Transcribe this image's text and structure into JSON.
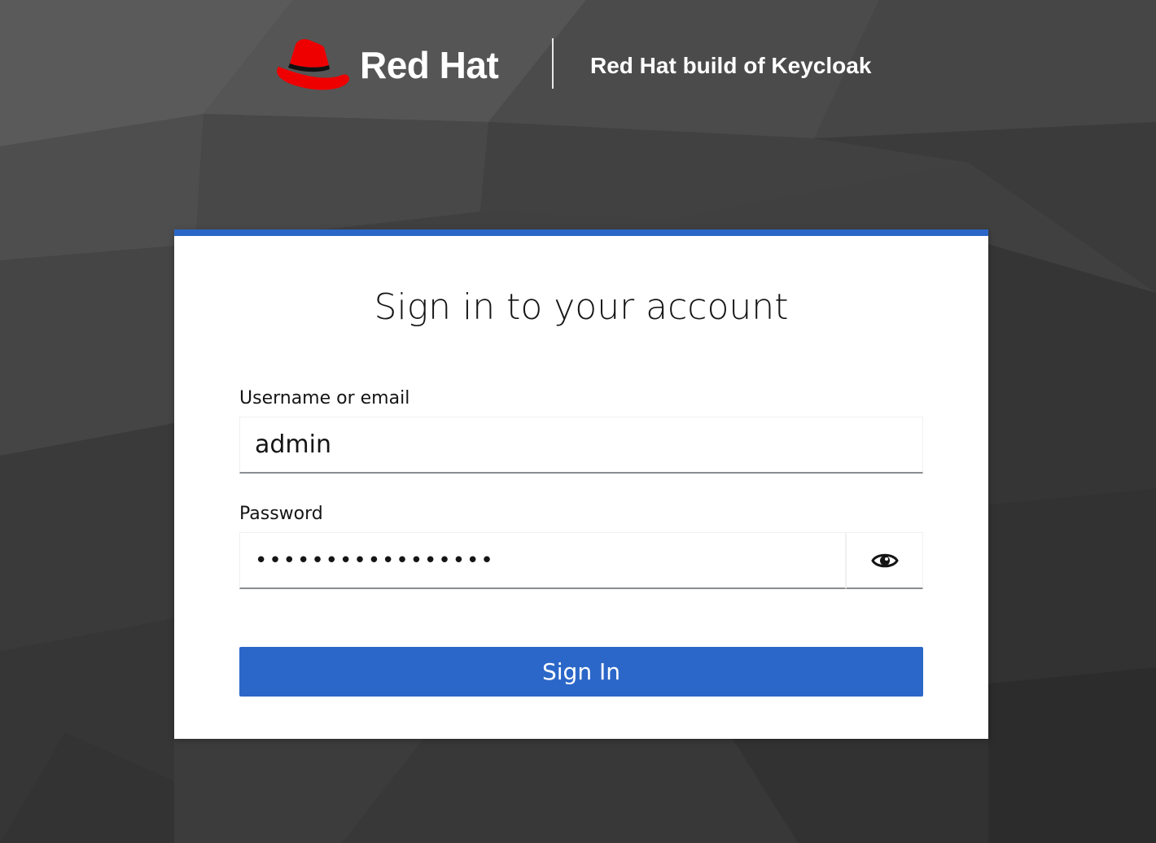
{
  "header": {
    "brand_name": "Red Hat",
    "product_name": "Red Hat build of Keycloak"
  },
  "login": {
    "title": "Sign in to your account",
    "username_label": "Username or email",
    "username_value": "admin",
    "password_label": "Password",
    "password_value": "•••••••••••••••••",
    "show_password_icon": "eye-icon",
    "submit_label": "Sign In"
  },
  "colors": {
    "background": "#3f3f3f",
    "brand_red": "#ee0000",
    "accent_blue": "#2b67c8",
    "card": "#ffffff",
    "text": "#151515"
  }
}
